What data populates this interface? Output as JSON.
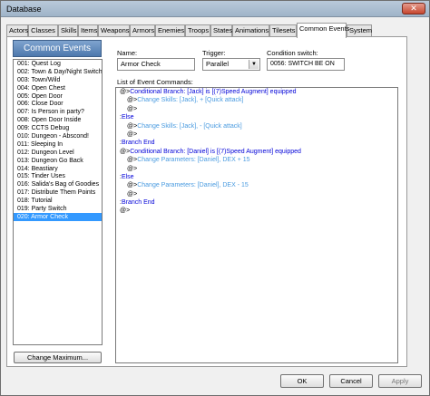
{
  "window": {
    "title": "Database",
    "close_glyph": "✕"
  },
  "tabs": [
    "Actors",
    "Classes",
    "Skills",
    "Items",
    "Weapons",
    "Armors",
    "Enemies",
    "Troops",
    "States",
    "Animations",
    "Tilesets",
    "Common Events",
    "System"
  ],
  "active_tab": "Common Events",
  "sidebar": {
    "header": "Common Events",
    "items": [
      "001: Quest Log",
      "002: Town & Day/Night Switch",
      "003: Town/Wild",
      "004: Open Chest",
      "005: Open Door",
      "006: Close Door",
      "007: Is Person in party?",
      "008: Open Door Inside",
      "009: CCTS Debug",
      "010: Dungeon - Abscond!",
      "011: Sleeping In",
      "012: Dungeon Level",
      "013: Dungeon Go Back",
      "014: Beastiary",
      "015: Tinder Uses",
      "016: Salida's Bag of Goodies",
      "017: Distribute Them Points",
      "018: Tutorial",
      "019: Party Switch",
      "020: Armor Check"
    ],
    "selected_index": 19,
    "change_max_label": "Change Maximum..."
  },
  "form": {
    "name_label": "Name:",
    "name_value": "Armor Check",
    "trigger_label": "Trigger:",
    "trigger_value": "Parallel",
    "condition_label": "Condition switch:",
    "condition_value": "0056: SWITCH BE ON"
  },
  "commands": {
    "label": "List of Event Commands:",
    "lines": [
      {
        "prefix": "@>",
        "text": "Conditional Branch: [Jack] is [(7)Speed Augment] equipped",
        "color": "blue",
        "indent": 0
      },
      {
        "prefix": "@>",
        "text": "Change Skills: [Jack], + [Quick attack]",
        "color": "light",
        "indent": 1
      },
      {
        "prefix": "@>",
        "text": "",
        "color": "black",
        "indent": 1
      },
      {
        "prefix": ":",
        "text": "Else",
        "color": "blue",
        "indent": 0
      },
      {
        "prefix": "@>",
        "text": "Change Skills: [Jack], - [Quick attack]",
        "color": "light",
        "indent": 1
      },
      {
        "prefix": "@>",
        "text": "",
        "color": "black",
        "indent": 1
      },
      {
        "prefix": ":",
        "text": "Branch End",
        "color": "blue",
        "indent": 0
      },
      {
        "prefix": "@>",
        "text": "Conditional Branch: [Daniel] is [(7)Speed Augment] equipped",
        "color": "blue",
        "indent": 0
      },
      {
        "prefix": "@>",
        "text": "Change Parameters: [Daniel], DEX + 15",
        "color": "light",
        "indent": 1
      },
      {
        "prefix": "@>",
        "text": "",
        "color": "black",
        "indent": 1
      },
      {
        "prefix": ":",
        "text": "Else",
        "color": "blue",
        "indent": 0
      },
      {
        "prefix": "@>",
        "text": "Change Parameters: [Daniel], DEX - 15",
        "color": "light",
        "indent": 1
      },
      {
        "prefix": "@>",
        "text": "",
        "color": "black",
        "indent": 1
      },
      {
        "prefix": ":",
        "text": "Branch End",
        "color": "blue",
        "indent": 0
      },
      {
        "prefix": "@>",
        "text": "",
        "color": "black",
        "indent": 0
      }
    ]
  },
  "buttons": {
    "ok": "OK",
    "cancel": "Cancel",
    "apply": "Apply"
  },
  "colors": {
    "blue": "#0000d8",
    "light": "#4a9be0",
    "black": "#000000",
    "selection": "#3399ff",
    "header": "#5a84b8"
  }
}
